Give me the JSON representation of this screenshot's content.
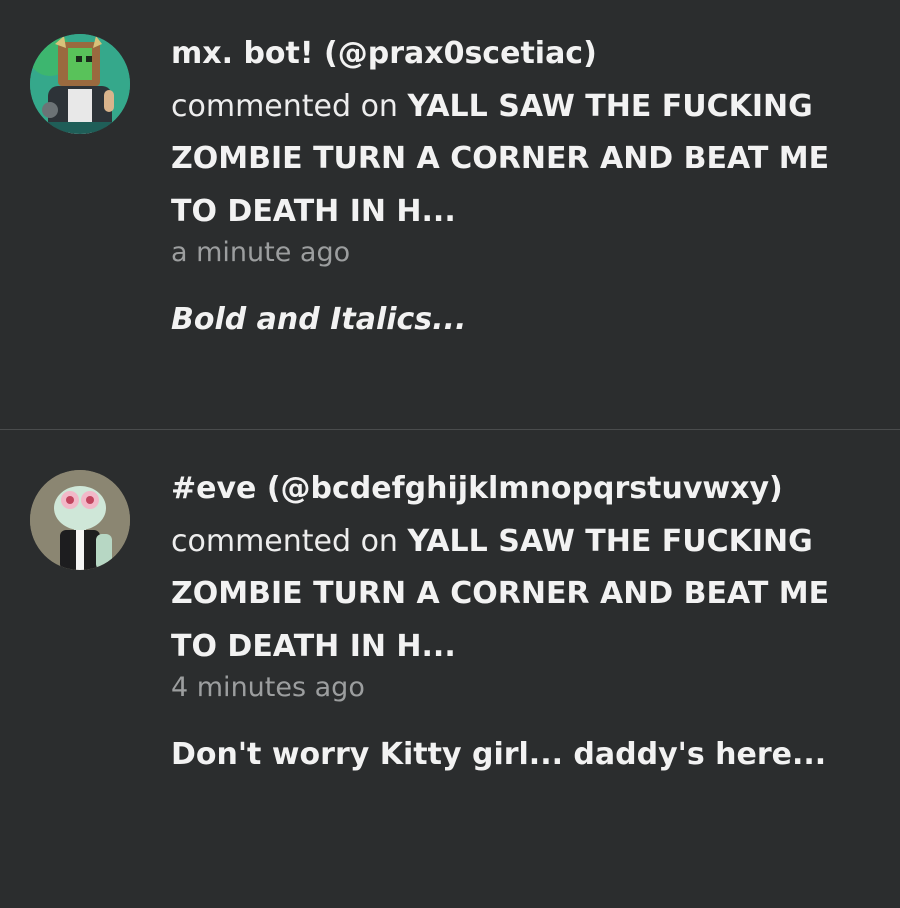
{
  "notifications": [
    {
      "handle": "mx. bot! (@prax0scetiac)",
      "verb": "commented on",
      "post_title": "YALL SAW THE FUCKING ZOMBIE TURN A CORNER AND BEAT ME TO DEATH IN H...",
      "timestamp": "a minute ago",
      "comment": "Bold and Italics...",
      "avatar_icon": "green-zombie-avatar-icon"
    },
    {
      "handle": "#eve (@bcdefghijklmnopqrstuvwxy)",
      "verb": "commented on",
      "post_title": "YALL SAW THE FUCKING ZOMBIE TURN A CORNER AND BEAT ME TO DEATH IN H...",
      "timestamp": "4 minutes ago",
      "comment": "Don't worry Kitty girl... daddy's here...",
      "avatar_icon": "cartoon-character-avatar-icon"
    }
  ],
  "colors": {
    "background": "#2b2d2e",
    "divider": "#4a4c4d",
    "text": "#f2f2f2",
    "muted": "#9c9e9f"
  }
}
